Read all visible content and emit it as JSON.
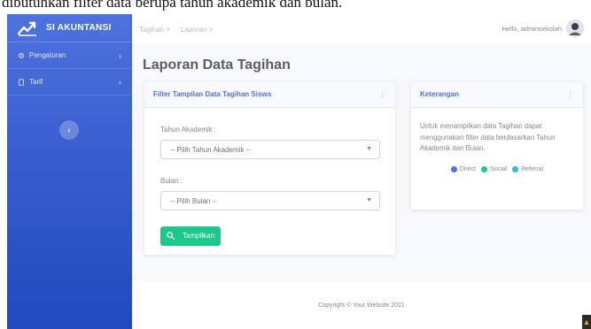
{
  "caption": "dibutuhkan filter data berupa tahun akademik dan bulan.",
  "sidebar": {
    "brand": "SI AKUNTANSI",
    "items": [
      {
        "label": "Pengaturan",
        "icon": "gear-icon"
      },
      {
        "label": "Tarif",
        "icon": "file-icon"
      }
    ],
    "toggle_icon": "chevron-left-icon"
  },
  "topbar": {
    "breadcrumbs": [
      "Tagihan >",
      "Laporan >"
    ],
    "greeting": "Hello, adminsekolah"
  },
  "page": {
    "title": "Laporan Data Tagihan"
  },
  "filter_card": {
    "title": "Filter Tampilan Data Tagihan Siswa",
    "tahun_label": "Tahun Akademik :",
    "tahun_selected": "-- Pilih Tahun Akademik --",
    "bulan_label": "Bulan :",
    "bulan_selected": "-- Pilih Bulan --",
    "button_label": "Tampilkan"
  },
  "info_card": {
    "title": "Keterangan",
    "text": "Untuk menampilkan data Tagihan dapat menggunakan filter data berdasarkan Tahun Akademik dan Bulan.",
    "legend": [
      {
        "label": "Direct",
        "color": "#4e73df"
      },
      {
        "label": "Social",
        "color": "#1cc88a"
      },
      {
        "label": "Referral",
        "color": "#36b9cc"
      }
    ]
  },
  "footer": {
    "copyright": "Copyright © Your Website 2021"
  },
  "colors": {
    "primary": "#4e73df",
    "success": "#1cc88a",
    "info": "#36b9cc"
  }
}
